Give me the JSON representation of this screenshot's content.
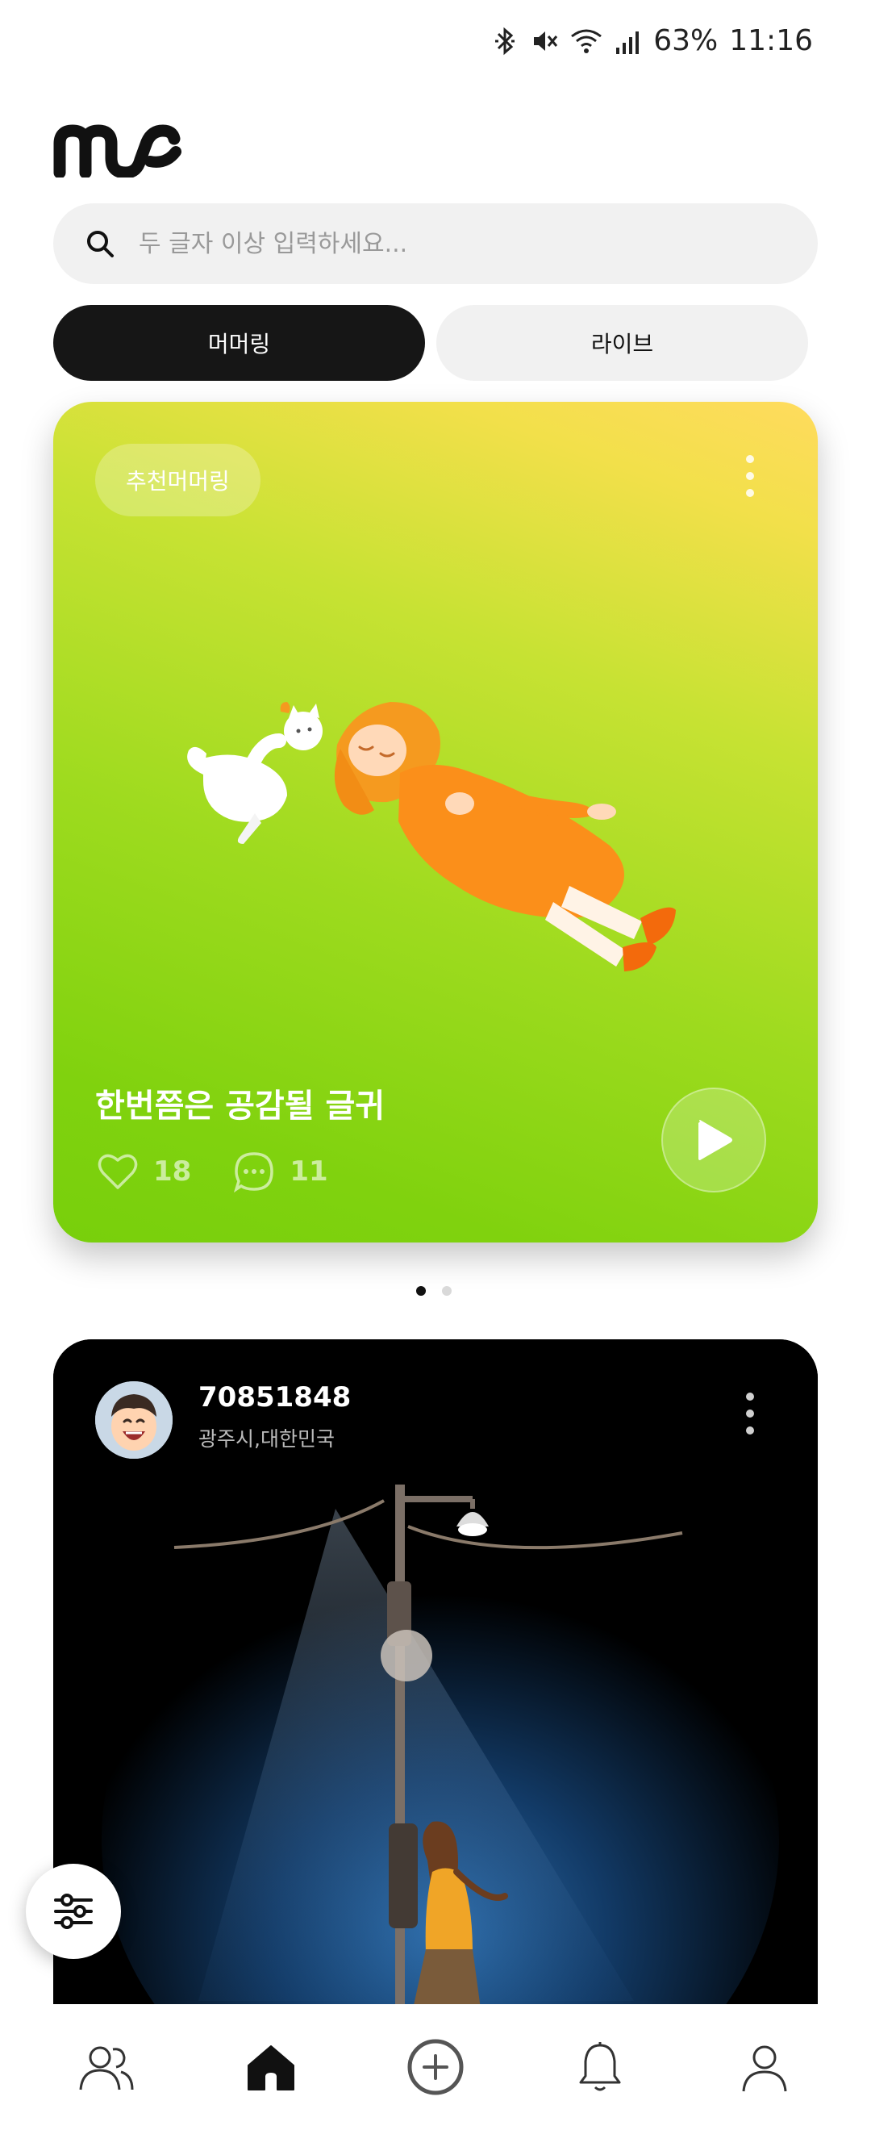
{
  "status_bar": {
    "battery": "63%",
    "time": "11:16"
  },
  "app": {
    "logo_text": "ms"
  },
  "search": {
    "placeholder": "두 글자 이상 입력하세요..."
  },
  "tabs": [
    {
      "label": "머머링",
      "active": true
    },
    {
      "label": "라이브",
      "active": false
    }
  ],
  "featured_card": {
    "badge": "추천머머링",
    "title": "한번쯤은 공감될 글귀",
    "likes": "18",
    "comments": "11"
  },
  "pager": {
    "pages": 2,
    "current": 1
  },
  "post_card": {
    "user_name": "70851848",
    "location": "광주시,대한민국"
  },
  "bottom_nav": [
    {
      "name": "people-icon"
    },
    {
      "name": "home-icon",
      "active": true
    },
    {
      "name": "add-circle-icon"
    },
    {
      "name": "bell-icon"
    },
    {
      "name": "profile-icon"
    }
  ],
  "colors": {
    "accent_dark": "#161616",
    "card_green": "#80d20e",
    "card_yellow": "#ffdb5e"
  }
}
